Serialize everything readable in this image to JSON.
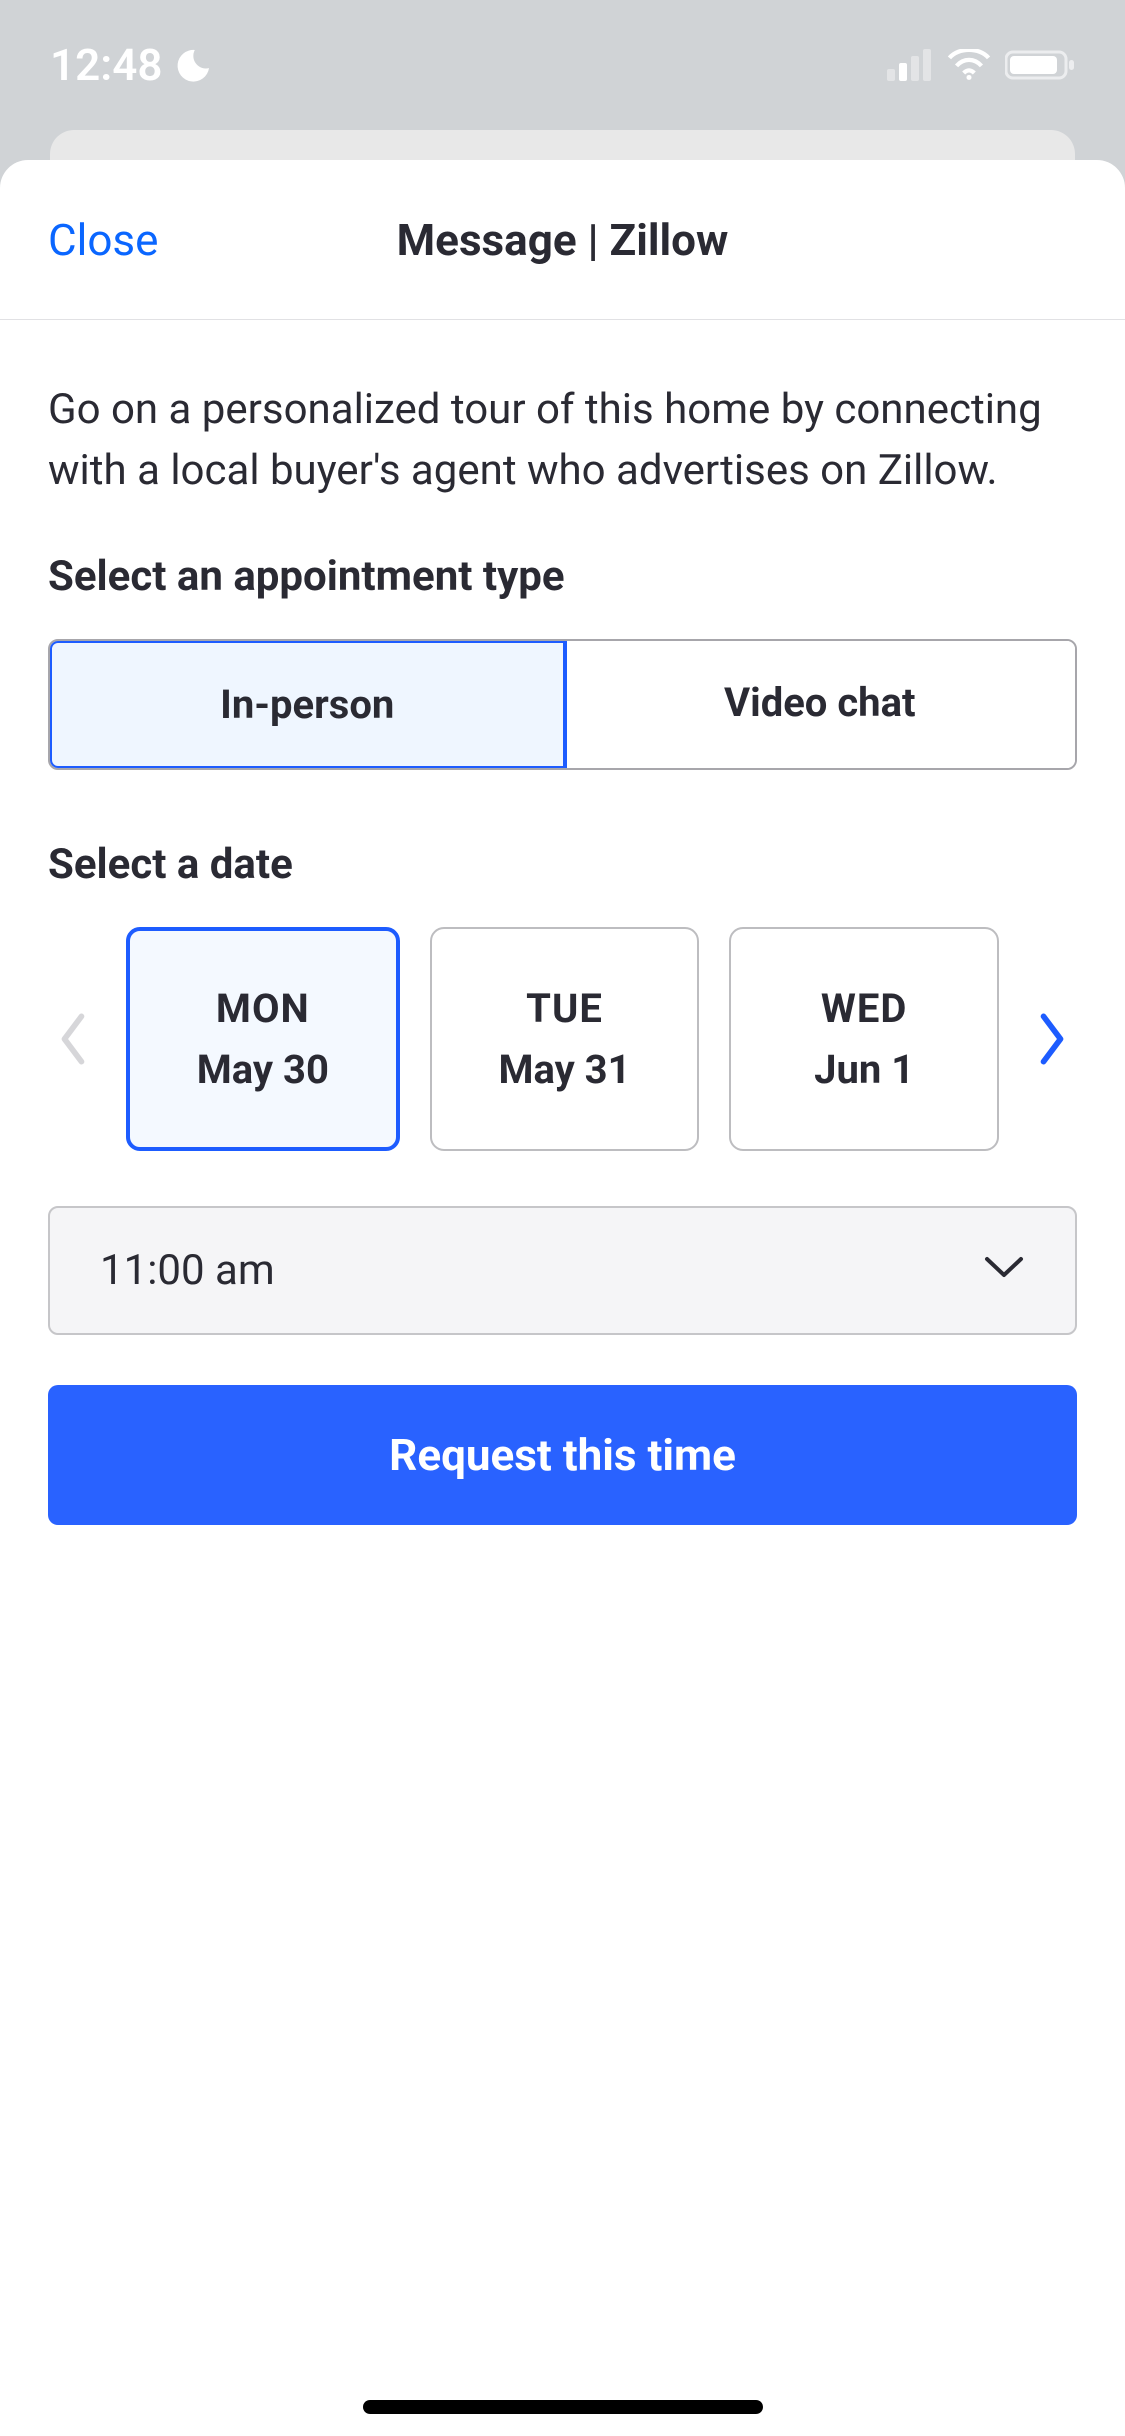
{
  "status": {
    "time": "12:48"
  },
  "sheet": {
    "close": "Close",
    "title": "Message | Zillow"
  },
  "intro": "Go on a personalized tour of this home by connecting with a local buyer's agent who advertises on Zillow.",
  "appointmentType": {
    "label": "Select an appointment type",
    "options": {
      "inPerson": "In-person",
      "video": "Video chat"
    }
  },
  "datePicker": {
    "label": "Select a date",
    "dates": [
      {
        "day": "MON",
        "date": "May 30"
      },
      {
        "day": "TUE",
        "date": "May 31"
      },
      {
        "day": "WED",
        "date": "Jun 1"
      }
    ]
  },
  "time": {
    "value": "11:00 am"
  },
  "cta": "Request this time"
}
